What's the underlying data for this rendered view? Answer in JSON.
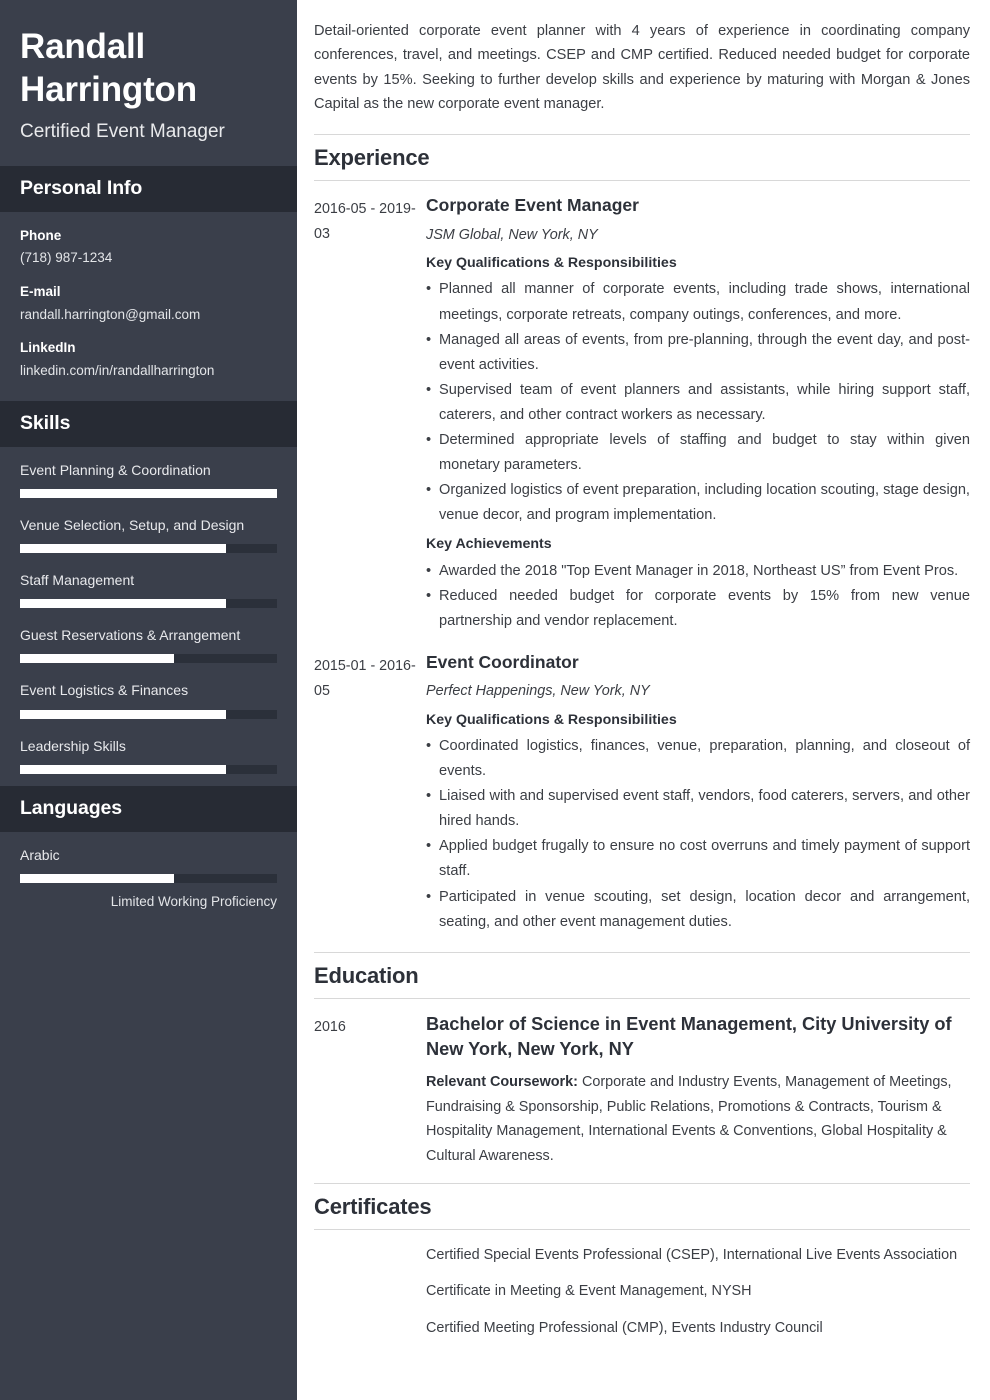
{
  "sidebar": {
    "name": "Randall Harrington",
    "job_title": "Certified Event Manager",
    "personal_info": {
      "heading": "Personal Info",
      "items": [
        {
          "label": "Phone",
          "value": "(718) 987-1234"
        },
        {
          "label": "E-mail",
          "value": "randall.harrington@gmail.com"
        },
        {
          "label": "LinkedIn",
          "value": "linkedin.com/in/randallharrington"
        }
      ]
    },
    "skills": {
      "heading": "Skills",
      "items": [
        {
          "label": "Event Planning & Coordination",
          "level": 100
        },
        {
          "label": "Venue Selection, Setup, and Design",
          "level": 80
        },
        {
          "label": "Staff Management",
          "level": 80
        },
        {
          "label": "Guest Reservations & Arrangement",
          "level": 60
        },
        {
          "label": "Event Logistics & Finances",
          "level": 80
        },
        {
          "label": "Leadership Skills",
          "level": 80
        }
      ]
    },
    "languages": {
      "heading": "Languages",
      "items": [
        {
          "label": "Arabic",
          "level": 60,
          "proficiency": "Limited Working Proficiency"
        }
      ]
    }
  },
  "main": {
    "summary": "Detail-oriented corporate event planner with 4 years of experience in coordinating company conferences, travel, and meetings. CSEP and CMP certified. Reduced needed budget for corporate events by 15%. Seeking to further develop skills and experience by maturing with Morgan & Jones Capital as the new corporate event manager.",
    "experience": {
      "heading": "Experience",
      "entries": [
        {
          "date": "2016-05 - 2019-03",
          "role": "Corporate Event Manager",
          "organization": "JSM Global, New York, NY",
          "qualifications_heading": "Key Qualifications & Responsibilities",
          "qualifications": [
            "Planned all manner of corporate events, including trade shows, international meetings, corporate retreats, company outings, conferences, and more.",
            "Managed all areas of events, from pre-planning, through the event day, and post-event activities.",
            "Supervised team of event planners and assistants, while hiring support staff, caterers, and other contract workers as necessary.",
            "Determined appropriate levels of staffing and budget to stay within given monetary parameters.",
            "Organized logistics of event preparation, including location scouting, stage design, venue decor, and program implementation."
          ],
          "achievements_heading": "Key Achievements",
          "achievements": [
            "Awarded the 2018 \"Top Event Manager in 2018, Northeast US” from Event Pros.",
            "Reduced needed budget for corporate events by 15% from new venue partnership and vendor replacement."
          ]
        },
        {
          "date": "2015-01 - 2016-05",
          "role": "Event Coordinator",
          "organization": "Perfect Happenings, New York, NY",
          "qualifications_heading": "Key Qualifications & Responsibilities",
          "qualifications": [
            "Coordinated logistics, finances, venue, preparation, planning, and closeout of events.",
            "Liaised with and supervised event staff, vendors, food caterers, servers, and other hired hands.",
            "Applied budget frugally to ensure no cost overruns and timely payment of support staff.",
            "Participated in venue scouting, set design, location decor and arrangement, seating, and other event management duties."
          ],
          "achievements_heading": "",
          "achievements": []
        }
      ]
    },
    "education": {
      "heading": "Education",
      "entries": [
        {
          "date": "2016",
          "degree": "Bachelor of Science in Event Management, City University of New York, New York, NY",
          "coursework_label": "Relevant Coursework:",
          "coursework": "Corporate and Industry Events, Management of Meetings, Fundraising & Sponsorship, Public Relations, Promotions & Contracts, Tourism & Hospitality Management, International Events & Conventions, Global Hospitality & Cultural Awareness."
        }
      ]
    },
    "certificates": {
      "heading": "Certificates",
      "items": [
        "Certified Special Events Professional (CSEP), International Live Events Association",
        "Certificate in Meeting & Event Management, NYSH",
        "Certified Meeting Professional (CMP), Events Industry Council"
      ]
    }
  }
}
